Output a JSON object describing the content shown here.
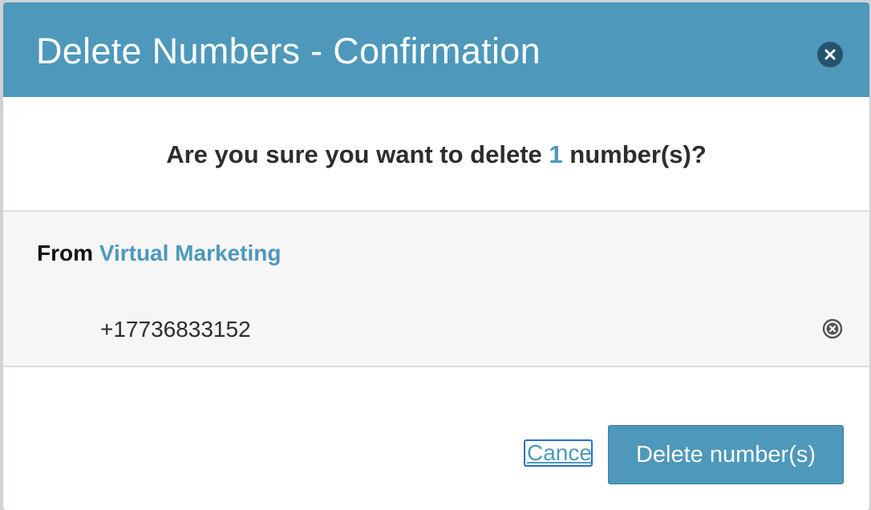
{
  "dialog": {
    "title": "Delete Numbers - Confirmation",
    "close_icon": "close-circle-icon",
    "question": {
      "prefix": "Are you sure you want to delete ",
      "count": "1",
      "suffix": " number(s)?"
    },
    "source": {
      "label": "From ",
      "name": "Virtual Marketing"
    },
    "numbers": [
      {
        "value": "+17736833152",
        "remove_icon": "remove-circle-icon"
      }
    ],
    "actions": {
      "cancel_label": "Cancel",
      "delete_label": "Delete number(s)"
    }
  },
  "colors": {
    "header": "#4d98bb",
    "accent": "#4d98bb",
    "close_icon_bg": "#24546b",
    "focus_ring": "#2d6bd2",
    "row_bg": "#f6f6f6"
  }
}
